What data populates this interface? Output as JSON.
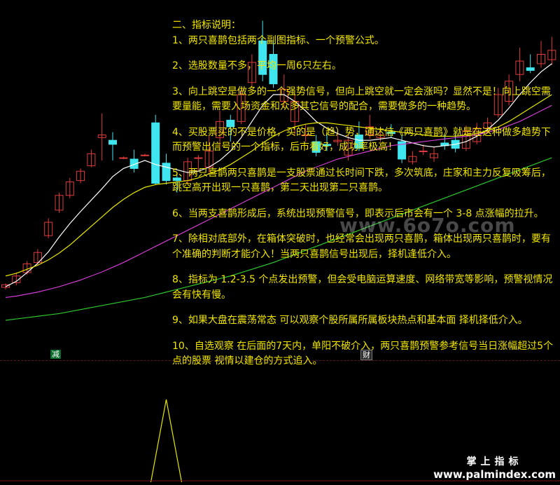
{
  "notes": {
    "title": "二、指标说明：",
    "items": [
      "1、两只喜鹊包括两个副图指标、一个预警公式。",
      "2、选股数量不多，平均一周6只左右。",
      "3、向上跳空是做多的一个强势信号，但向上跳空就一定会涨吗？显然不是！向上跳空需要量能，需要入场资金和众多其它信号的配合，需要做多的一种趋势。",
      "4、买股票买的不是价格，买的是（趋）势，通达信《两只喜鹊》就是在这种做多趋势下而预警出信号的一个指标，后市看好，成功率极高！",
      "5、两只喜鹊两只喜鹊是一支股票通过长时间下跌，多次筑底，庄家和主力反复吸筹后，跳空高开出现一只喜鹊，第二天出现第二只喜鹊。",
      "6、当两支喜鹊形成后，系统出现预警信号，即表示后市会有一个 3-8 点涨幅的拉升。",
      "7、除相对底部外，在箱体突破时，也经常会出现两只喜鹊，箱体出现两只喜鹊时，要有个准确的判断才能介入！当两只喜鹊信号出现后，择机逢低介入。",
      "8、指标为 1.2-3.5 个点发出预警，但会受电脑运算速度、网络带宽等影响，预警视情况会有快有慢。",
      "9、如果大盘在震荡常态 可以观察个股所属所属板块热点和基本面 择机择低介入。",
      "10、自选观察 在后面的7天内，单阳不破介入，两只喜鹊预警参考信号当日涨幅超过5个点的股票 视情以建仓的方式追入。"
    ]
  },
  "badges": {
    "left": "减",
    "right": "财"
  },
  "watermark": "www.6o7o.com",
  "brand": {
    "cn": "掌上指标",
    "url": "www.palmindex.com"
  },
  "colors": {
    "background": "#000000",
    "up": "#e03a3a",
    "down": "#3fe6f0",
    "text": "#f2e600",
    "ma_white": "#ffffff",
    "ma_yellow": "#e8e800",
    "ma_magenta": "#d23cd2",
    "ma_green": "#2ec82e"
  },
  "chart_data": {
    "type": "candlestick",
    "candles": [
      {
        "o": 73,
        "c": 77,
        "h": 79,
        "l": 70
      },
      {
        "o": 80,
        "c": 90,
        "h": 95,
        "l": 76
      },
      {
        "o": 95,
        "c": 108,
        "h": 112,
        "l": 92
      },
      {
        "o": 110,
        "c": 125,
        "h": 130,
        "l": 106
      },
      {
        "o": 150,
        "c": 170,
        "h": 176,
        "l": 146
      },
      {
        "o": 188,
        "c": 210,
        "h": 214,
        "l": 184
      },
      {
        "o": 210,
        "c": 230,
        "h": 236,
        "l": 206
      },
      {
        "o": 232,
        "c": 246,
        "h": 250,
        "l": 228
      },
      {
        "o": 254,
        "c": 272,
        "h": 278,
        "l": 252
      },
      {
        "o": 296,
        "c": 300,
        "h": 332,
        "l": 262
      },
      {
        "o": 292,
        "c": 286,
        "h": 304,
        "l": 262
      },
      {
        "o": 266,
        "c": 266,
        "h": 268,
        "l": 264
      },
      {
        "o": 264,
        "c": 250,
        "h": 278,
        "l": 244
      },
      {
        "o": 270,
        "c": 270,
        "h": 272,
        "l": 268
      },
      {
        "o": 318,
        "c": 228,
        "h": 330,
        "l": 226
      },
      {
        "o": 258,
        "c": 232,
        "h": 272,
        "l": 226
      },
      {
        "o": 236,
        "c": 232,
        "h": 240,
        "l": 214
      },
      {
        "o": 232,
        "c": 260,
        "h": 266,
        "l": 226
      },
      {
        "o": 266,
        "c": 266,
        "h": 270,
        "l": 246
      },
      {
        "o": 252,
        "c": 276,
        "h": 300,
        "l": 244
      },
      {
        "o": 296,
        "c": 320,
        "h": 336,
        "l": 280
      },
      {
        "o": 322,
        "c": 312,
        "h": 330,
        "l": 290
      },
      {
        "o": 320,
        "c": 360,
        "h": 370,
        "l": 316
      },
      {
        "o": 378,
        "c": 408,
        "h": 420,
        "l": 372
      },
      {
        "o": 440,
        "c": 390,
        "h": 470,
        "l": 380
      },
      {
        "o": 420,
        "c": 376,
        "h": 440,
        "l": 370
      },
      {
        "o": 350,
        "c": 368,
        "h": 390,
        "l": 340
      },
      {
        "o": 320,
        "c": 350,
        "h": 360,
        "l": 300
      },
      {
        "o": 300,
        "c": 300,
        "h": 316,
        "l": 290
      },
      {
        "o": 290,
        "c": 274,
        "h": 300,
        "l": 268
      },
      {
        "o": 286,
        "c": 284,
        "h": 300,
        "l": 276
      },
      {
        "o": 290,
        "c": 292,
        "h": 306,
        "l": 284
      },
      {
        "o": 270,
        "c": 292,
        "h": 300,
        "l": 262
      },
      {
        "o": 300,
        "c": 280,
        "h": 320,
        "l": 276
      },
      {
        "o": 300,
        "c": 312,
        "h": 330,
        "l": 294
      },
      {
        "o": 296,
        "c": 300,
        "h": 310,
        "l": 290
      },
      {
        "o": 304,
        "c": 302,
        "h": 316,
        "l": 296
      },
      {
        "o": 290,
        "c": 264,
        "h": 300,
        "l": 258
      },
      {
        "o": 260,
        "c": 268,
        "h": 276,
        "l": 256
      },
      {
        "o": 276,
        "c": 276,
        "h": 286,
        "l": 270
      },
      {
        "o": 266,
        "c": 272,
        "h": 282,
        "l": 260
      },
      {
        "o": 288,
        "c": 284,
        "h": 300,
        "l": 278
      },
      {
        "o": 292,
        "c": 280,
        "h": 306,
        "l": 274
      },
      {
        "o": 280,
        "c": 306,
        "h": 314,
        "l": 276
      },
      {
        "o": 290,
        "c": 310,
        "h": 318,
        "l": 286
      },
      {
        "o": 310,
        "c": 318,
        "h": 326,
        "l": 304
      },
      {
        "o": 330,
        "c": 360,
        "h": 370,
        "l": 326
      },
      {
        "o": 350,
        "c": 380,
        "h": 390,
        "l": 344
      },
      {
        "o": 390,
        "c": 410,
        "h": 430,
        "l": 380
      },
      {
        "o": 400,
        "c": 396,
        "h": 420,
        "l": 392
      },
      {
        "o": 406,
        "c": 420,
        "h": 440,
        "l": 400
      },
      {
        "o": 412,
        "c": 426,
        "h": 446,
        "l": 404
      }
    ],
    "ma_white": [
      74,
      82,
      95,
      109,
      126,
      148,
      168,
      186,
      203,
      220,
      238,
      250,
      256,
      262,
      256,
      252,
      248,
      244,
      246,
      252,
      262,
      276,
      296,
      320,
      344,
      360,
      360,
      350,
      336,
      320,
      310,
      302,
      296,
      292,
      292,
      294,
      296,
      292,
      288,
      284,
      282,
      284,
      286,
      290,
      298,
      308,
      322,
      340,
      360,
      378,
      394,
      406
    ],
    "ma_yellow": [
      90,
      94,
      100,
      106,
      114,
      124,
      136,
      150,
      164,
      178,
      192,
      204,
      214,
      222,
      226,
      228,
      230,
      232,
      236,
      242,
      248,
      256,
      266,
      276,
      288,
      298,
      306,
      312,
      316,
      318,
      318,
      316,
      314,
      312,
      310,
      308,
      306,
      304,
      302,
      300,
      298,
      298,
      298,
      300,
      302,
      306,
      312,
      320,
      330,
      340,
      350,
      360
    ],
    "ma_magenta": [
      58,
      60,
      63,
      66,
      70,
      74,
      79,
      84,
      90,
      96,
      103,
      110,
      118,
      126,
      134,
      142,
      150,
      158,
      166,
      174,
      182,
      190,
      198,
      206,
      214,
      222,
      230,
      238,
      246,
      252,
      258,
      264,
      268,
      272,
      276,
      280,
      284,
      286,
      288,
      290,
      292,
      294,
      296,
      298,
      300,
      304,
      308,
      314,
      320,
      328,
      336,
      344
    ],
    "ma_green": [
      24,
      26,
      28,
      30,
      32,
      34,
      37,
      40,
      43,
      46,
      49,
      52,
      55,
      58,
      62,
      66,
      70,
      74,
      78,
      82,
      86,
      90,
      95,
      100,
      105,
      110,
      116,
      122,
      128,
      134,
      140,
      146,
      152,
      158,
      164,
      170,
      176,
      182,
      188,
      194,
      200,
      206,
      212,
      218,
      224,
      230,
      236,
      242,
      248,
      254,
      260,
      266
    ],
    "ylim": [
      0,
      480
    ],
    "signal": {
      "index": 15,
      "value": 1,
      "ylim": [
        0,
        1
      ]
    }
  }
}
